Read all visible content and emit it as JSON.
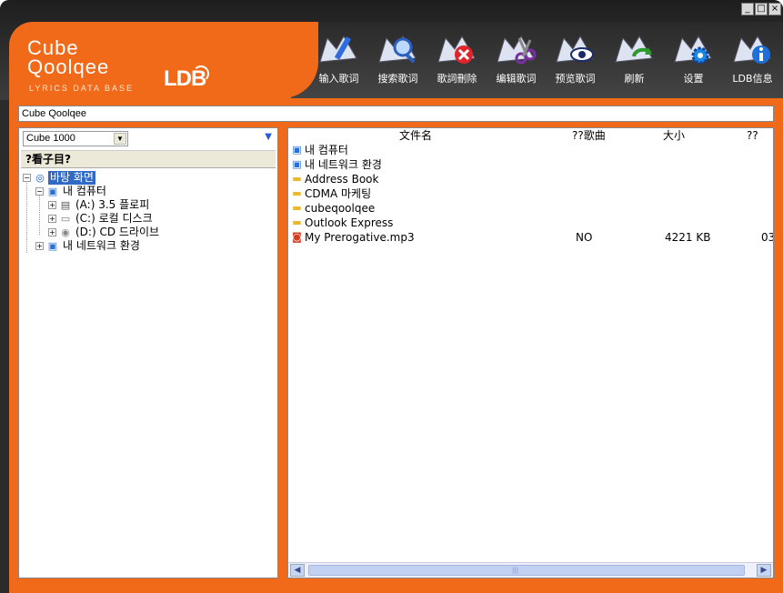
{
  "window": {
    "controls": [
      "_",
      "□",
      "×"
    ]
  },
  "logo": {
    "line1": "Cube",
    "line2": "Qoolqee",
    "tagline": "LYRICS DATA BASE",
    "badge": "LDB"
  },
  "toolbar": [
    {
      "label": "输入歌词",
      "icon": "input-lyrics-icon"
    },
    {
      "label": "搜索歌词",
      "icon": "search-lyrics-icon"
    },
    {
      "label": "歌詞刪除",
      "icon": "delete-lyrics-icon"
    },
    {
      "label": "编辑歌词",
      "icon": "edit-lyrics-icon"
    },
    {
      "label": "预览歌词",
      "icon": "preview-lyrics-icon"
    },
    {
      "label": "刷新",
      "icon": "refresh-icon"
    },
    {
      "label": "设置",
      "icon": "settings-icon"
    },
    {
      "label": "LDB信息",
      "icon": "info-icon"
    }
  ],
  "path": "Cube Qoolqee",
  "left_pane": {
    "drive_select": "Cube 1000",
    "header": "?看子目?",
    "tree": [
      {
        "label": "바탕 화면",
        "icon": "desktop-icon",
        "expander": "−",
        "selected": true
      },
      {
        "label": "내 컴퓨터",
        "icon": "computer-icon",
        "expander": "−"
      },
      {
        "label": "(A:) 3.5 플로피",
        "icon": "floppy-icon",
        "expander": "+"
      },
      {
        "label": "(C:) 로컬 디스크",
        "icon": "hard-disk-icon",
        "expander": "+"
      },
      {
        "label": "(D:) CD 드라이브",
        "icon": "cd-drive-icon",
        "expander": "+"
      },
      {
        "label": "내 네트워크 환경",
        "icon": "network-icon",
        "expander": "+"
      }
    ]
  },
  "file_list": {
    "columns": [
      "文件名",
      "??歌曲",
      "大小",
      "??"
    ],
    "rows": [
      {
        "name": "내 컴퓨터",
        "icon": "computer-icon",
        "lyrics": "",
        "size": "",
        "extra": ""
      },
      {
        "name": "내 네트워크 환경",
        "icon": "network-icon",
        "lyrics": "",
        "size": "",
        "extra": ""
      },
      {
        "name": "Address Book",
        "icon": "folder-icon",
        "lyrics": "",
        "size": "",
        "extra": ""
      },
      {
        "name": "CDMA 마케팅",
        "icon": "folder-icon",
        "lyrics": "",
        "size": "",
        "extra": ""
      },
      {
        "name": "cubeqoolqee",
        "icon": "folder-icon",
        "lyrics": "",
        "size": "",
        "extra": ""
      },
      {
        "name": "Outlook Express",
        "icon": "folder-icon",
        "lyrics": "",
        "size": "",
        "extra": ""
      },
      {
        "name": "My Prerogative.mp3",
        "icon": "mp3-file-icon",
        "lyrics": "NO",
        "size": "4221 KB",
        "extra": "03"
      }
    ]
  },
  "colors": {
    "accent": "#f06a1a",
    "selection": "#316ac5"
  }
}
